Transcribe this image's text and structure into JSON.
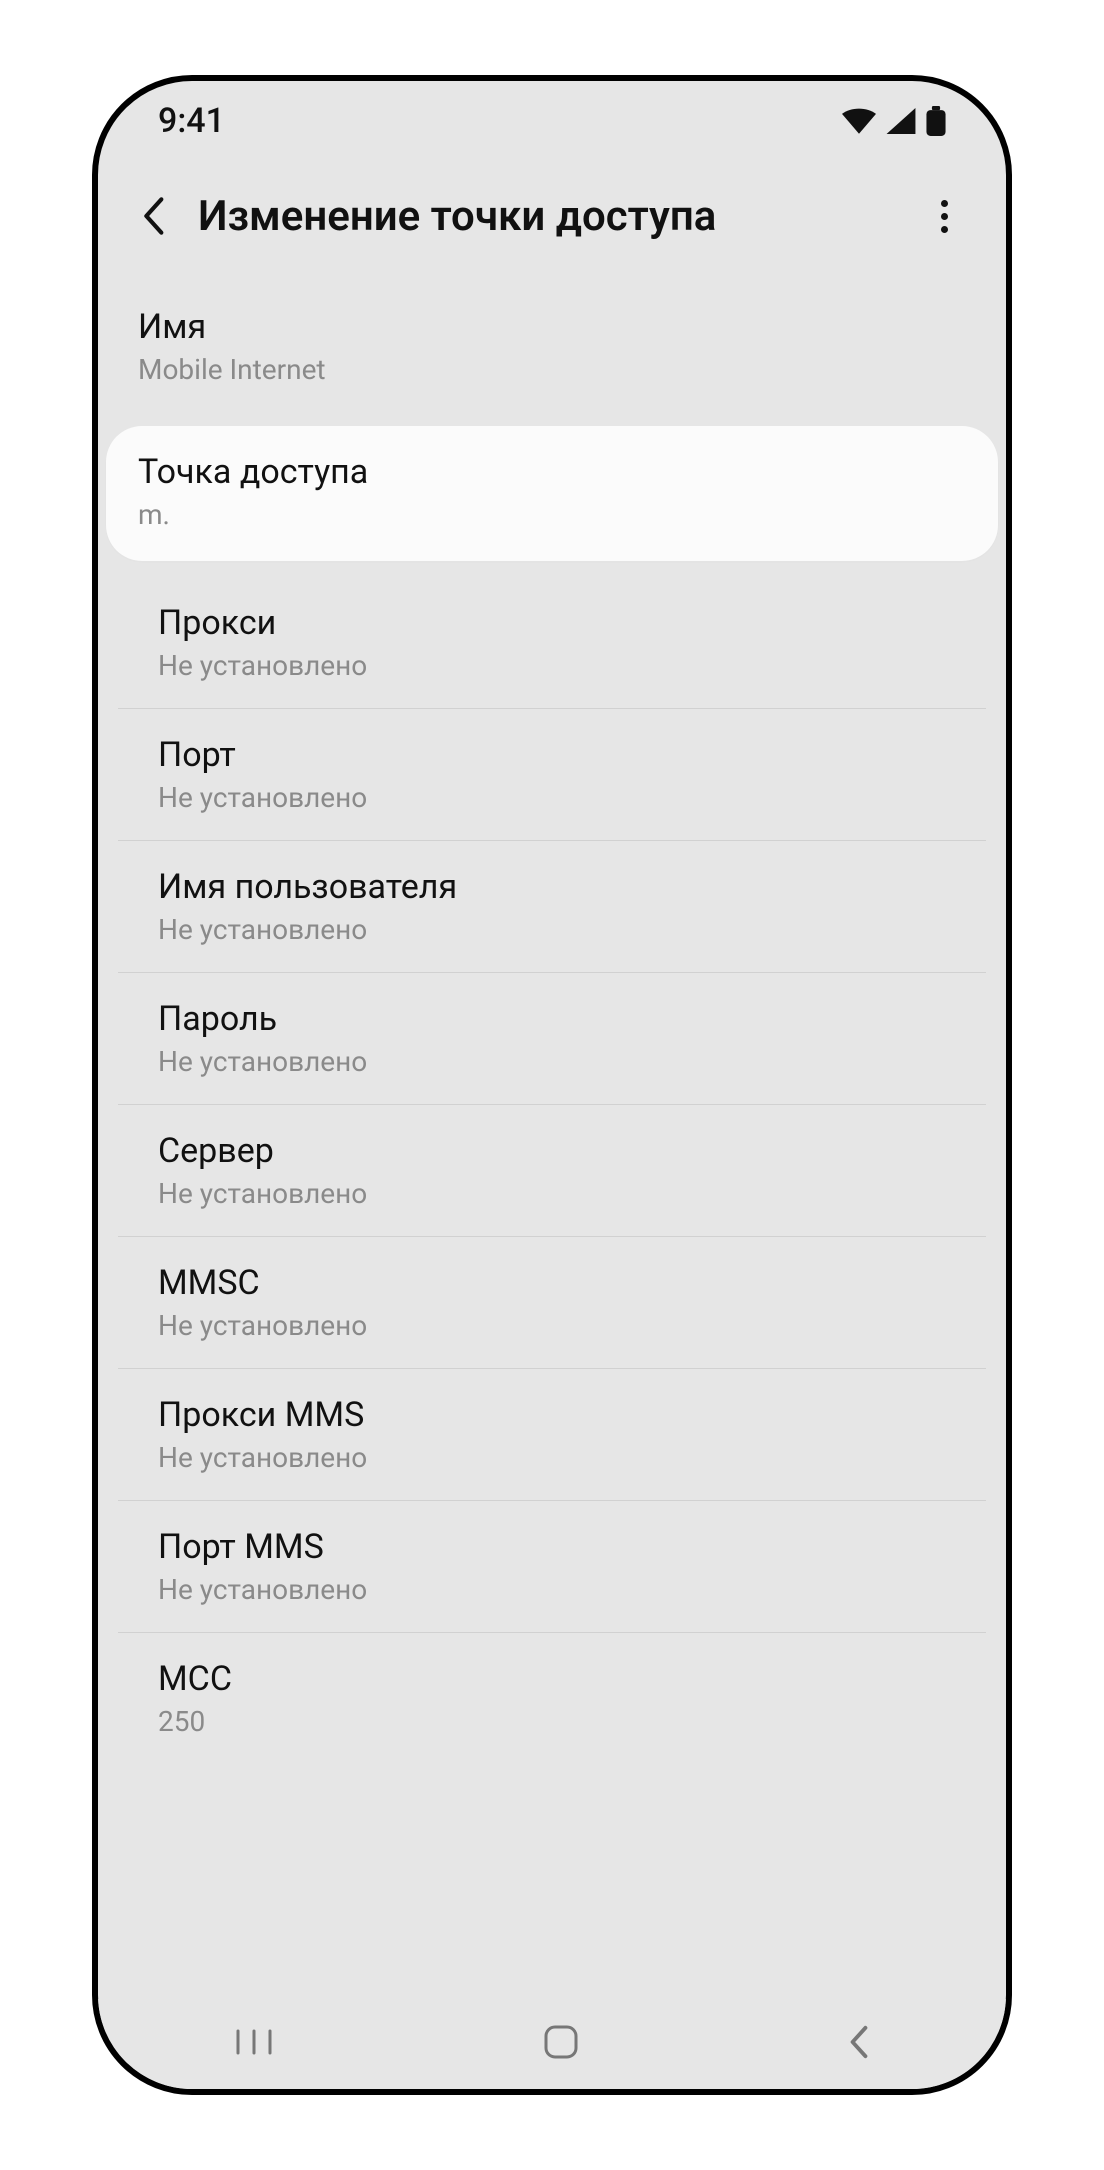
{
  "statusbar": {
    "time": "9:41"
  },
  "header": {
    "title": "Изменение точки доступа"
  },
  "rows": {
    "name": {
      "label": "Имя",
      "value": "Mobile Internet"
    },
    "apn": {
      "label": "Точка доступа",
      "value": "m."
    },
    "proxy": {
      "label": "Прокси",
      "value": "Не установлено"
    },
    "port": {
      "label": "Порт",
      "value": "Не установлено"
    },
    "username": {
      "label": "Имя пользователя",
      "value": "Не установлено"
    },
    "password": {
      "label": "Пароль",
      "value": "Не установлено"
    },
    "server": {
      "label": "Сервер",
      "value": "Не установлено"
    },
    "mmsc": {
      "label": "MMSC",
      "value": "Не установлено"
    },
    "mmsproxy": {
      "label": "Прокси MMS",
      "value": "Не установлено"
    },
    "mmsport": {
      "label": "Порт MMS",
      "value": "Не установлено"
    },
    "mcc": {
      "label": "MCC",
      "value": "250"
    }
  }
}
